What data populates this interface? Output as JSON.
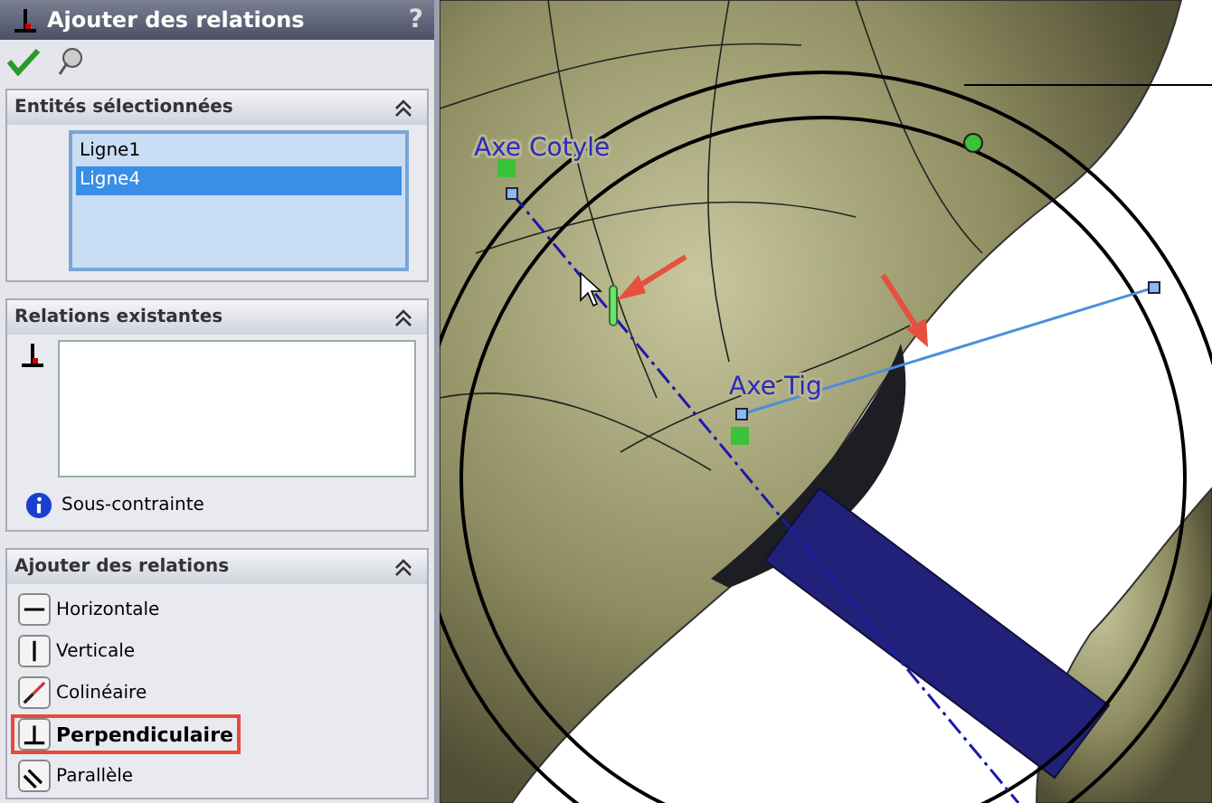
{
  "panel": {
    "title": "Ajouter des relations",
    "help": "?"
  },
  "selected_entities": {
    "title": "Entités sélectionnées",
    "items": [
      {
        "label": "Ligne1",
        "selected": false
      },
      {
        "label": "Ligne4",
        "selected": true
      }
    ]
  },
  "existing_relations": {
    "title": "Relations existantes",
    "status": "Sous-contrainte"
  },
  "add_relations": {
    "title": "Ajouter des relations",
    "items": [
      {
        "kind": "horizontal",
        "label": "Horizontale",
        "selected": false
      },
      {
        "kind": "vertical",
        "label": "Verticale",
        "selected": false
      },
      {
        "kind": "collinear",
        "label": "Colinéaire",
        "selected": false
      },
      {
        "kind": "perpendicular",
        "label": "Perpendiculaire",
        "selected": true
      },
      {
        "kind": "parallel",
        "label": "Parallèle",
        "selected": false
      }
    ]
  },
  "viewport": {
    "labels": [
      {
        "kind": "cotyle",
        "text": "Axe Cotyle"
      },
      {
        "kind": "tige",
        "text": "Axe Tig"
      }
    ]
  }
}
